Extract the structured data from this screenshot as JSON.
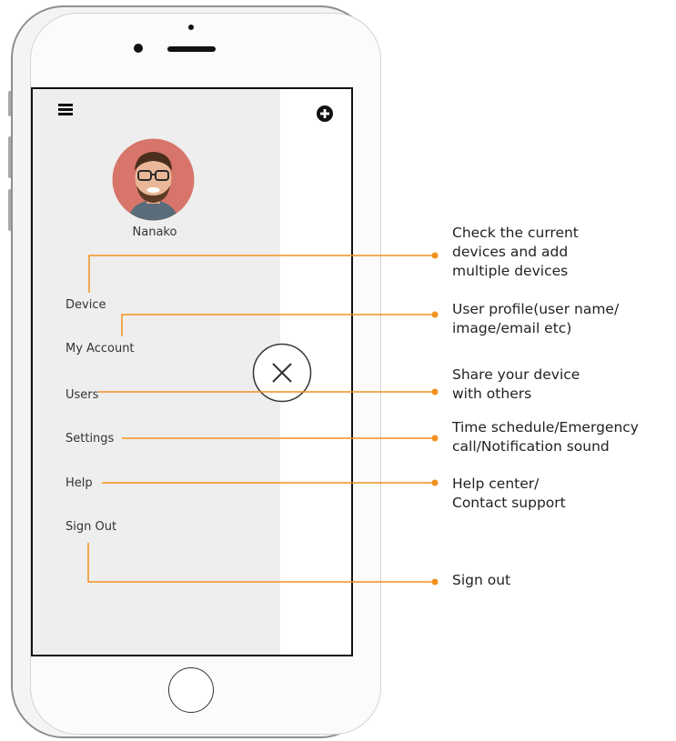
{
  "accent_color": "#f0921f",
  "screen": {
    "menu_icon": "hamburger-icon",
    "add_icon": "plus-circle-icon",
    "user_name": "Nanako",
    "menu_items": [
      "Device",
      "My Account",
      "Users",
      "Settings",
      "Help",
      "Sign Out"
    ],
    "close_icon": "close-x-icon"
  },
  "annotations": [
    {
      "target": "Device",
      "lines": [
        "Check the current",
        "devices and add",
        "multiple devices"
      ]
    },
    {
      "target": "My Account",
      "lines": [
        "User profile(user name/",
        "image/email etc)"
      ]
    },
    {
      "target": "Users",
      "lines": [
        "Share your device",
        "with others"
      ]
    },
    {
      "target": "Settings",
      "lines": [
        "Time schedule/Emergency",
        "call/Notification sound"
      ]
    },
    {
      "target": "Help",
      "lines": [
        "Help center/",
        "Contact support"
      ]
    },
    {
      "target": "Sign Out",
      "lines": [
        "Sign out"
      ]
    }
  ]
}
